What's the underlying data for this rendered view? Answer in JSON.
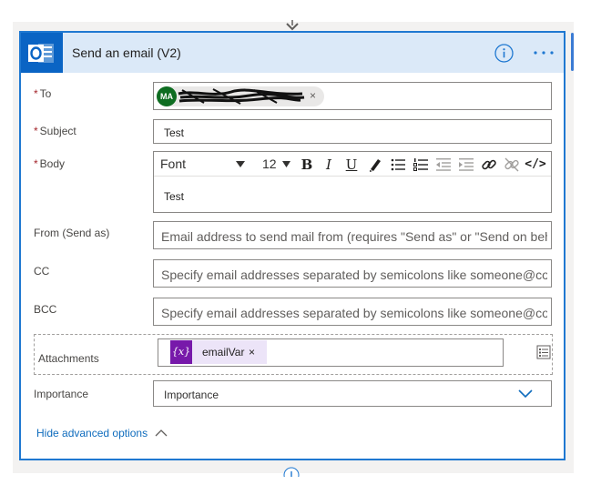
{
  "action": {
    "title": "Send an email (V2)",
    "info_icon": "info-circle-icon",
    "more_icon": "ellipsis-icon",
    "brand_color": "#0a64c4",
    "accent_color": "#1f78d1"
  },
  "fields": {
    "to": {
      "label": "To",
      "required_mark": "*",
      "recipient_initials": "MA",
      "remove_glyph": "×"
    },
    "subject": {
      "label": "Subject",
      "required_mark": "*",
      "value": "Test"
    },
    "body": {
      "label": "Body",
      "required_mark": "*",
      "font_select": "Font",
      "size_select": "12",
      "value": "Test",
      "toolbar": {
        "bold": "B",
        "italic": "I",
        "underline": "U",
        "code": "</>"
      }
    },
    "from": {
      "label": "From (Send as)",
      "placeholder": "Email address to send mail from (requires \"Send as\" or \"Send on beh"
    },
    "cc": {
      "label": "CC",
      "placeholder": "Specify email addresses separated by semicolons like someone@con"
    },
    "bcc": {
      "label": "BCC",
      "placeholder": "Specify email addresses separated by semicolons like someone@con"
    },
    "attachments": {
      "label": "Attachments",
      "token_icon_text": "{x}",
      "token_label": "emailVar",
      "token_remove": "×"
    },
    "importance": {
      "label": "Importance",
      "value": "Importance"
    }
  },
  "footer": {
    "hide_advanced": "Hide advanced options"
  }
}
